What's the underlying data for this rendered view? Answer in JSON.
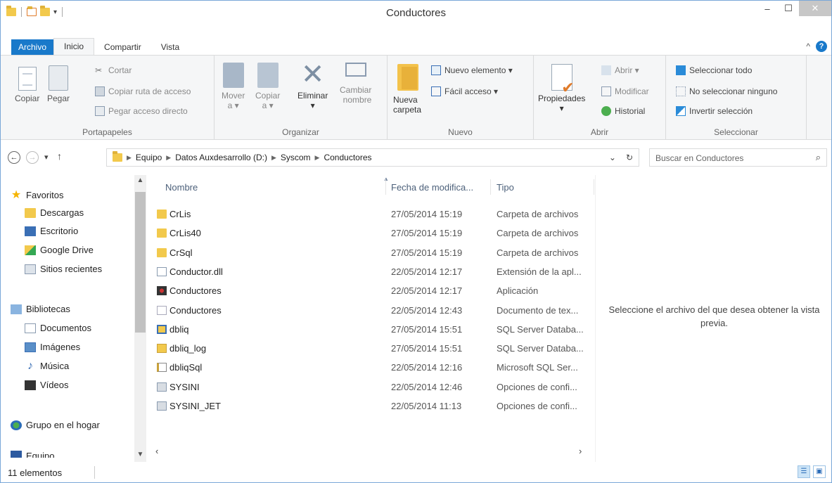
{
  "window": {
    "title": "Conductores",
    "minimize": "–",
    "maximize": "☐",
    "close": "✕"
  },
  "ribbon_tabs": [
    "Archivo",
    "Inicio",
    "Compartir",
    "Vista"
  ],
  "ribbon": {
    "portapapeles": {
      "copiar": "Copiar",
      "pegar": "Pegar",
      "cortar": "Cortar",
      "copiar_ruta": "Copiar ruta de acceso",
      "pegar_acceso": "Pegar acceso directo",
      "label": "Portapapeles"
    },
    "organizar": {
      "mover_1": "Mover",
      "mover_2": "a ▾",
      "copiar_1": "Copiar",
      "copiar_2": "a ▾",
      "eliminar": "Eliminar",
      "eliminar_arrow": "▾",
      "cambiar_1": "Cambiar",
      "cambiar_2": "nombre",
      "label": "Organizar"
    },
    "nuevo": {
      "nueva_1": "Nueva",
      "nueva_2": "carpeta",
      "nuevo_elemento": "Nuevo elemento ▾",
      "facil_acceso": "Fácil acceso ▾",
      "label": "Nuevo"
    },
    "abrir": {
      "propiedades": "Propiedades",
      "propiedades_arrow": "▾",
      "abrir": "Abrir ▾",
      "modificar": "Modificar",
      "historial": "Historial",
      "label": "Abrir"
    },
    "seleccionar": {
      "todo": "Seleccionar todo",
      "ninguno": "No seleccionar ninguno",
      "invertir": "Invertir selección",
      "label": "Seleccionar"
    }
  },
  "address": {
    "crumbs": [
      "Equipo",
      "Datos Auxdesarrollo (D:)",
      "Syscom",
      "Conductores"
    ],
    "search_placeholder": "Buscar en Conductores"
  },
  "nav": {
    "favoritos": "Favoritos",
    "descargas": "Descargas",
    "escritorio": "Escritorio",
    "google_drive": "Google Drive",
    "sitios_recientes": "Sitios recientes",
    "bibliotecas": "Bibliotecas",
    "documentos": "Documentos",
    "imagenes": "Imágenes",
    "musica": "Música",
    "videos": "Vídeos",
    "grupo_hogar": "Grupo en el hogar",
    "equipo": "Equipo"
  },
  "columns": {
    "name": "Nombre",
    "date": "Fecha de modifica...",
    "type": "Tipo"
  },
  "files": [
    {
      "name": "CrLis",
      "date": "27/05/2014 15:19",
      "type": "Carpeta de archivos",
      "icon": "folder-icon"
    },
    {
      "name": "CrLis40",
      "date": "27/05/2014 15:19",
      "type": "Carpeta de archivos",
      "icon": "folder-icon"
    },
    {
      "name": "CrSql",
      "date": "27/05/2014 15:19",
      "type": "Carpeta de archivos",
      "icon": "folder-icon"
    },
    {
      "name": "Conductor.dll",
      "date": "22/05/2014 12:17",
      "type": "Extensión de la apl...",
      "icon": "dll-icon"
    },
    {
      "name": "Conductores",
      "date": "22/05/2014 12:17",
      "type": "Aplicación",
      "icon": "application-icon"
    },
    {
      "name": "Conductores",
      "date": "22/05/2014 12:43",
      "type": "Documento de tex...",
      "icon": "text-document-icon"
    },
    {
      "name": "dbliq",
      "date": "27/05/2014 15:51",
      "type": "SQL Server Databa...",
      "icon": "database-icon"
    },
    {
      "name": "dbliq_log",
      "date": "27/05/2014 15:51",
      "type": "SQL Server Databa...",
      "icon": "database-log-icon"
    },
    {
      "name": "dbliqSql",
      "date": "22/05/2014 12:16",
      "type": "Microsoft SQL Ser...",
      "icon": "sql-file-icon"
    },
    {
      "name": "SYSINI",
      "date": "22/05/2014 12:46",
      "type": "Opciones de confi...",
      "icon": "config-file-icon"
    },
    {
      "name": "SYSINI_JET",
      "date": "22/05/2014 11:13",
      "type": "Opciones de confi...",
      "icon": "config-file-icon"
    }
  ],
  "preview_text": "Seleccione el archivo del que desea obtener la vista previa.",
  "status": {
    "count": "11 elementos"
  }
}
